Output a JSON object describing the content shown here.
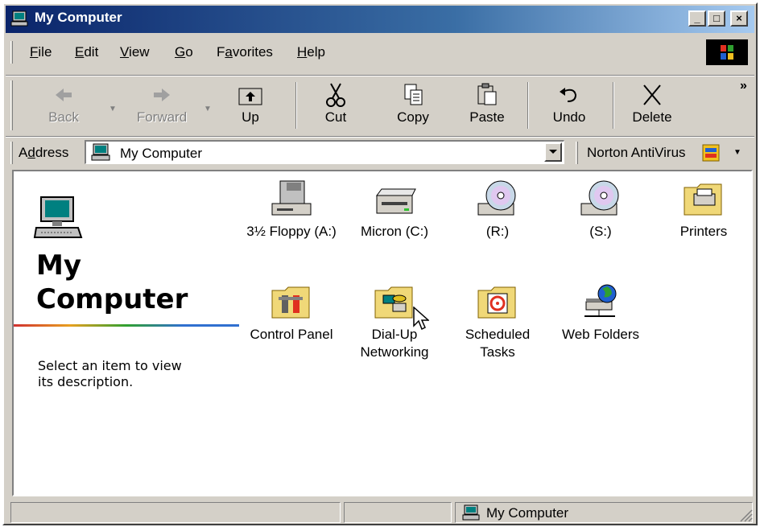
{
  "window": {
    "title": "My Computer"
  },
  "menu": {
    "items": [
      {
        "pre": "",
        "key": "F",
        "post": "ile"
      },
      {
        "pre": "",
        "key": "E",
        "post": "dit"
      },
      {
        "pre": "",
        "key": "V",
        "post": "iew"
      },
      {
        "pre": "",
        "key": "G",
        "post": "o"
      },
      {
        "pre": "F",
        "key": "a",
        "post": "vorites"
      },
      {
        "pre": "",
        "key": "H",
        "post": "elp"
      }
    ]
  },
  "toolbar": {
    "back": "Back",
    "forward": "Forward",
    "up": "Up",
    "cut": "Cut",
    "copy": "Copy",
    "paste": "Paste",
    "undo": "Undo",
    "delete": "Delete",
    "more": "»"
  },
  "address": {
    "label_pre": "A",
    "label_key": "d",
    "label_post": "dress",
    "value": "My Computer",
    "extra": "Norton AntiVirus"
  },
  "left_panel": {
    "title_line1": "My",
    "title_line2": "Computer",
    "description_line1": "Select an item to view",
    "description_line2": "its description."
  },
  "drives": [
    {
      "line1": "3½ Floppy (A:)",
      "line2": "",
      "icon": "floppy-drive-icon"
    },
    {
      "line1": "Micron (C:)",
      "line2": "",
      "icon": "hard-drive-icon"
    },
    {
      "line1": "(R:)",
      "line2": "",
      "icon": "cd-drive-icon"
    },
    {
      "line1": "(S:)",
      "line2": "",
      "icon": "cd-drive-icon"
    },
    {
      "line1": "Printers",
      "line2": "",
      "icon": "printers-folder-icon"
    },
    {
      "line1": "Control Panel",
      "line2": "",
      "icon": "control-panel-folder-icon"
    },
    {
      "line1": "Dial-Up",
      "line2": "Networking",
      "icon": "dialup-networking-folder-icon"
    },
    {
      "line1": "Scheduled",
      "line2": "Tasks",
      "icon": "scheduled-tasks-folder-icon"
    },
    {
      "line1": "Web Folders",
      "line2": "",
      "icon": "web-folders-icon"
    }
  ],
  "status": {
    "text": "My Computer"
  },
  "colors": {
    "title_start": "#0a246a",
    "title_end": "#a6caf0",
    "face": "#d4d0c8"
  }
}
